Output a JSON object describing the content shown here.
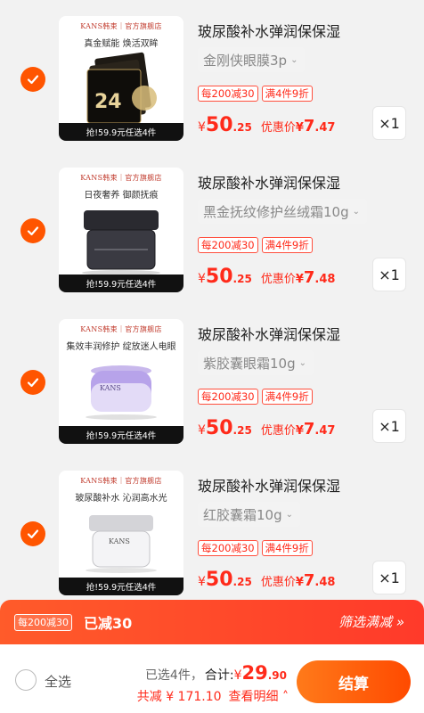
{
  "items": [
    {
      "title": "玻尿酸补水弹润保保湿",
      "spec": "金刚侠眼膜3p",
      "promo1": "每200减30",
      "promo2": "满4件9折",
      "price_currency": "¥",
      "price_int": "50",
      "price_dec": ".25",
      "discount_label": "优惠价",
      "discount_currency": "¥",
      "discount_int": "7",
      "discount_dec": ".47",
      "qty": "×1",
      "thumb": {
        "brand": "KANS韩束｜官方旗舰店",
        "tag": "真金赋能 焕活双眸",
        "strip": "抢!59.9元任选4件"
      }
    },
    {
      "title": "玻尿酸补水弹润保保湿",
      "spec": "黑金抚纹修护丝绒霜10g",
      "promo1": "每200减30",
      "promo2": "满4件9折",
      "price_currency": "¥",
      "price_int": "50",
      "price_dec": ".25",
      "discount_label": "优惠价",
      "discount_currency": "¥",
      "discount_int": "7",
      "discount_dec": ".48",
      "qty": "×1",
      "thumb": {
        "brand": "KANS韩束｜官方旗舰店",
        "tag": "日夜奢养 御颜抚痕",
        "strip": "抢!59.9元任选4件"
      }
    },
    {
      "title": "玻尿酸补水弹润保保湿",
      "spec": "紫胶囊眼霜10g",
      "promo1": "每200减30",
      "promo2": "满4件9折",
      "price_currency": "¥",
      "price_int": "50",
      "price_dec": ".25",
      "discount_label": "优惠价",
      "discount_currency": "¥",
      "discount_int": "7",
      "discount_dec": ".47",
      "qty": "×1",
      "thumb": {
        "brand": "KANS韩束｜官方旗舰店",
        "tag": "集效丰润修护 绽放迷人电眼",
        "strip": "抢!59.9元任选4件"
      }
    },
    {
      "title": "玻尿酸补水弹润保保湿",
      "spec": "红胶囊霜10g",
      "promo1": "每200减30",
      "promo2": "满4件9折",
      "price_currency": "¥",
      "price_int": "50",
      "price_dec": ".25",
      "discount_label": "优惠价",
      "discount_currency": "¥",
      "discount_int": "7",
      "discount_dec": ".48",
      "qty": "×1",
      "thumb": {
        "brand": "KANS韩束｜官方旗舰店",
        "tag": "玻尿酸补水 沁润高水光",
        "strip": "抢!59.9元任选4件"
      }
    }
  ],
  "promo_bar": {
    "badge": "每200减30",
    "saved": "已减30",
    "filter": "筛选满减 »"
  },
  "bottom_bar": {
    "select_all": "全选",
    "selected_count": "已选4件，",
    "total_label": "合计:",
    "total_currency": "¥",
    "total_int": "29",
    "total_dec": ".90",
    "saved_total": "共减 ¥ 171.10",
    "detail": "查看明细 ˄",
    "checkout": "结算"
  },
  "colors": {
    "accent": "#ff5500",
    "price": "#ff2a1a",
    "checkout_start": "#ff7a1a",
    "checkout_end": "#ff4a00"
  }
}
